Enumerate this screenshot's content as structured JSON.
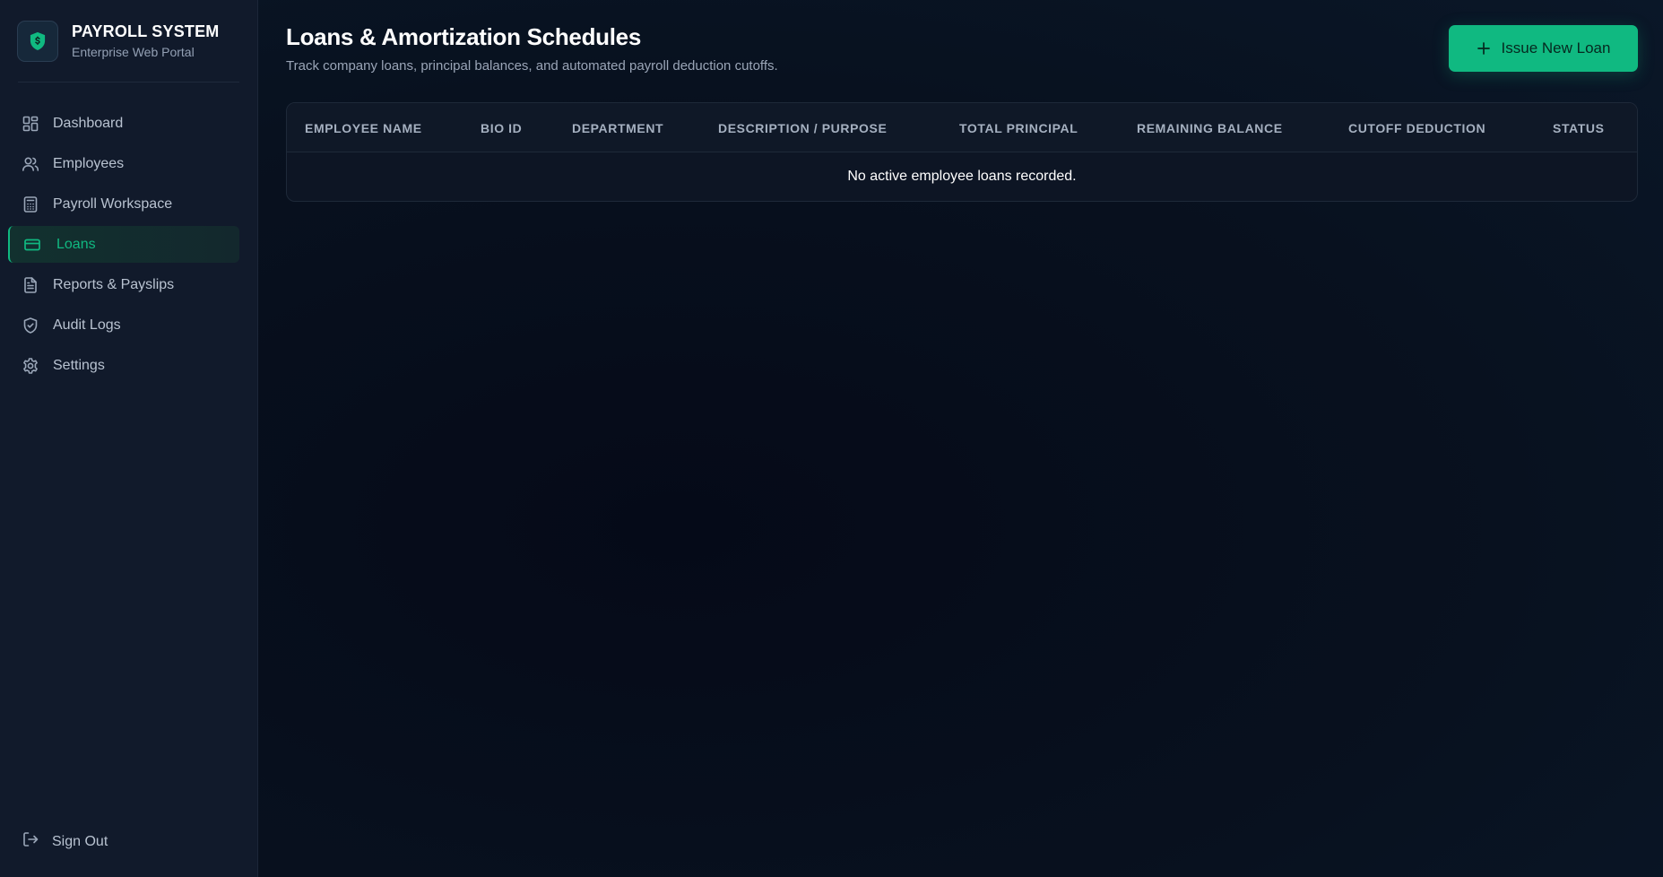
{
  "brand": {
    "title": "PAYROLL SYSTEM",
    "subtitle": "Enterprise Web Portal",
    "icon": "shield-dollar-icon"
  },
  "sidebar": {
    "items": [
      {
        "label": "Dashboard",
        "icon": "grid-icon",
        "active": false
      },
      {
        "label": "Employees",
        "icon": "users-icon",
        "active": false
      },
      {
        "label": "Payroll Workspace",
        "icon": "calculator-icon",
        "active": false
      },
      {
        "label": "Loans",
        "icon": "credit-card-icon",
        "active": true
      },
      {
        "label": "Reports & Payslips",
        "icon": "file-text-icon",
        "active": false
      },
      {
        "label": "Audit Logs",
        "icon": "shield-check-icon",
        "active": false
      },
      {
        "label": "Settings",
        "icon": "gear-icon",
        "active": false
      }
    ],
    "signout_label": "Sign Out"
  },
  "header": {
    "title": "Loans & Amortization Schedules",
    "subtitle": "Track company loans, principal balances, and automated payroll deduction cutoffs.",
    "action_label": "Issue New Loan"
  },
  "table": {
    "columns": [
      "EMPLOYEE NAME",
      "BIO ID",
      "DEPARTMENT",
      "DESCRIPTION / PURPOSE",
      "TOTAL PRINCIPAL",
      "REMAINING BALANCE",
      "CUTOFF DEDUCTION",
      "STATUS"
    ],
    "empty_message": "No active employee loans recorded."
  },
  "colors": {
    "accent": "#10b981",
    "sidebar_bg": "#111a2b",
    "main_bg": "#070d1c"
  }
}
